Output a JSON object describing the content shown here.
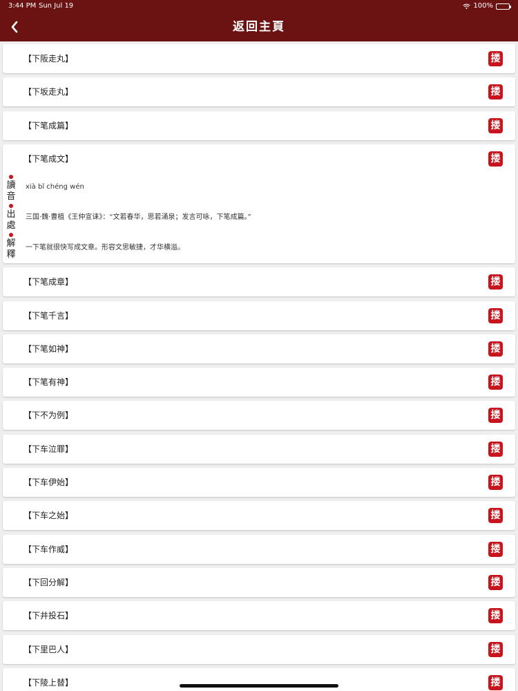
{
  "status": {
    "time": "3:44 PM",
    "date": "Sun Jul 19",
    "battery": "100%"
  },
  "nav": {
    "title": "返回主頁"
  },
  "rows": [
    {
      "title": "【下阪走丸】"
    },
    {
      "title": "【下坂走丸】"
    },
    {
      "title": "【下笔成篇】"
    },
    {
      "title": "【下笔成文】",
      "expanded": true,
      "pinyin": "xià bǐ chéng wén",
      "source": "三国·魏·曹植《王仲宣诔》：“文若春华，思若涌泉；发言可咏，下笔成篇。”",
      "meaning": "一下笔就很快写成文章。形容文思敏捷，才华横溢。"
    },
    {
      "title": "【下笔成章】"
    },
    {
      "title": "【下笔千言】"
    },
    {
      "title": "【下笔如神】"
    },
    {
      "title": "【下笔有神】"
    },
    {
      "title": "【下不为例】"
    },
    {
      "title": "【下车泣罪】"
    },
    {
      "title": "【下车伊始】"
    },
    {
      "title": "【下车之始】"
    },
    {
      "title": "【下车作威】"
    },
    {
      "title": "【下回分解】"
    },
    {
      "title": "【下井投石】"
    },
    {
      "title": "【下里巴人】"
    },
    {
      "title": "【下陵上替】"
    }
  ],
  "side_labels": [
    "讀",
    "音",
    "出",
    "處",
    "解",
    "釋"
  ],
  "seal_glyph": "搂",
  "colors": {
    "nav_bg": "#6b1313",
    "seal": "#c8141c",
    "list_bg": "#efefef"
  }
}
